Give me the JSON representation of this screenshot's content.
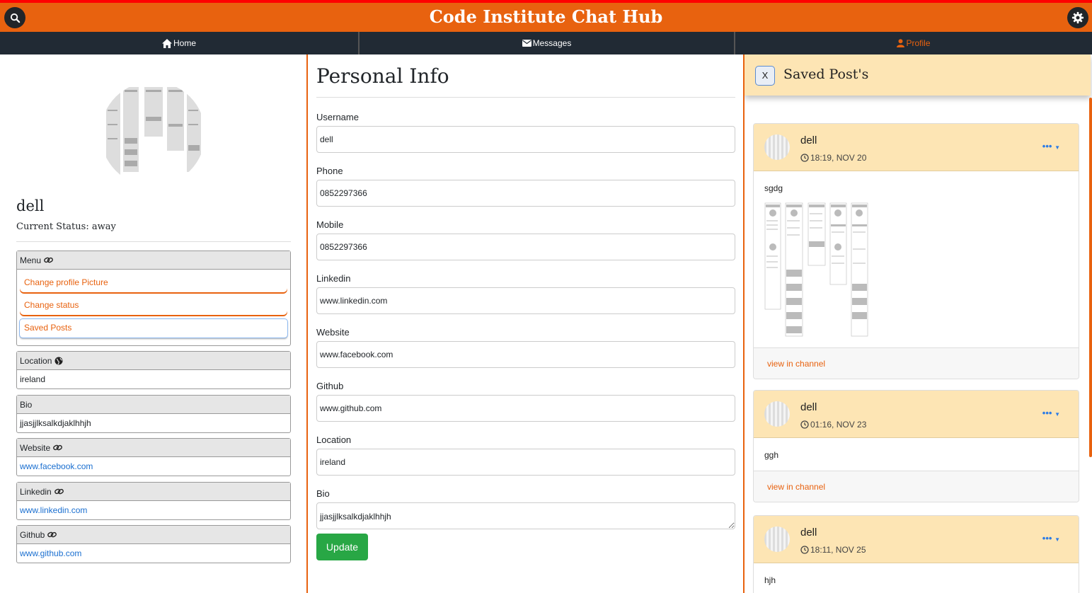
{
  "app": {
    "title": "Code Institute Chat Hub",
    "accent_color": "#e8620f",
    "search_icon": "search-icon",
    "settings_icon": "gear-icon"
  },
  "nav": {
    "home": "Home",
    "messages": "Messages",
    "profile": "Profile",
    "active": "Profile"
  },
  "profile": {
    "username": "dell",
    "status": "Current Status: away",
    "menu": {
      "title": "Menu",
      "items": [
        "Change profile Picture",
        "Change status",
        "Saved Posts"
      ]
    },
    "location": {
      "title": "Location",
      "value": "ireland"
    },
    "bio": {
      "title": "Bio",
      "value": "jjasjjlksalkdjaklhhjh"
    },
    "website": {
      "title": "Website",
      "value": "www.facebook.com"
    },
    "linkedin": {
      "title": "Linkedin",
      "value": "www.linkedin.com"
    },
    "github": {
      "title": "Github",
      "value": "www.github.com"
    }
  },
  "personal_info": {
    "heading": "Personal Info",
    "fields": {
      "username": {
        "label": "Username",
        "value": "dell"
      },
      "phone": {
        "label": "Phone",
        "value": "0852297366"
      },
      "mobile": {
        "label": "Mobile",
        "value": "0852297366"
      },
      "linkedin": {
        "label": "Linkedin",
        "value": "www.linkedin.com"
      },
      "website": {
        "label": "Website",
        "value": "www.facebook.com"
      },
      "github": {
        "label": "Github",
        "value": "www.github.com"
      },
      "location": {
        "label": "Location",
        "value": "ireland"
      },
      "bio": {
        "label": "Bio",
        "value": "jjasjjlksalkdjaklhhjh"
      }
    },
    "update_button": "Update"
  },
  "saved_posts": {
    "close_label": "X",
    "title": "Saved Post's",
    "view_label": "view in channel",
    "dots_label": "•••",
    "posts": [
      {
        "author": "dell",
        "time": "18:19, NOV 20",
        "text": "sgdg",
        "has_image": true
      },
      {
        "author": "dell",
        "time": "01:16, NOV 23",
        "text": "ggh",
        "has_image": false
      },
      {
        "author": "dell",
        "time": "18:11, NOV 25",
        "text": "hjh",
        "has_image": false
      }
    ]
  }
}
